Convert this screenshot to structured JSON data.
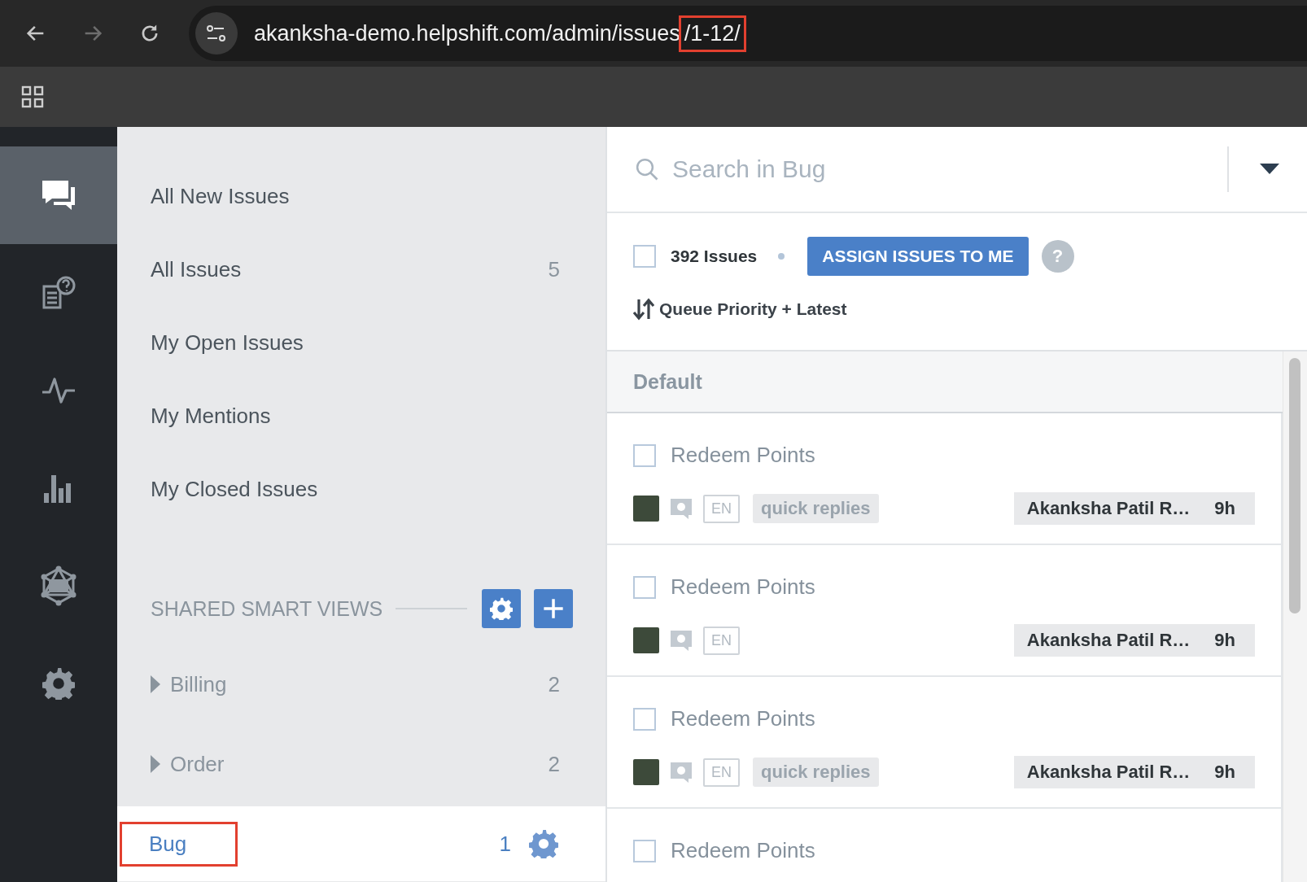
{
  "browser": {
    "url": "akanksha-demo.helpshift.com/admin/issues",
    "url_highlight": "/1-12/"
  },
  "rail": [
    {
      "kind": "chat",
      "selected": true
    },
    {
      "kind": "faq",
      "selected": false
    },
    {
      "kind": "pulse",
      "selected": false
    },
    {
      "kind": "chart",
      "selected": false
    },
    {
      "kind": "ai",
      "selected": false
    },
    {
      "kind": "gear",
      "selected": false
    }
  ],
  "nav": {
    "items": [
      {
        "label": "All New Issues"
      },
      {
        "label": "All Issues",
        "count": "5"
      },
      {
        "label": "My Open Issues"
      },
      {
        "label": "My Mentions"
      },
      {
        "label": "My Closed Issues"
      }
    ]
  },
  "shared_views": {
    "title": "SHARED SMART VIEWS",
    "items": [
      {
        "label": "Billing",
        "count": "2",
        "expandable": true,
        "selected": false,
        "highlighted": false
      },
      {
        "label": "Order",
        "count": "2",
        "expandable": true,
        "selected": false,
        "highlighted": false
      },
      {
        "label": "Bug",
        "count": "1",
        "expandable": false,
        "selected": true,
        "highlighted": true
      }
    ]
  },
  "search": {
    "placeholder": "Search in Bug"
  },
  "bulk": {
    "checked": false,
    "count": "392 Issues",
    "button": "ASSIGN ISSUES TO ME",
    "help": "?"
  },
  "sort": {
    "label": "Queue Priority + Latest"
  },
  "queue": {
    "title": "Default",
    "issues": [
      {
        "title": "Redeem Points",
        "checked": false,
        "language": "EN",
        "tags": [
          "quick replies"
        ],
        "assignee": "Akanksha Patil R…",
        "age": "9h"
      },
      {
        "title": "Redeem Points",
        "checked": false,
        "language": "EN",
        "assignee": "Akanksha Patil R…",
        "age": "9h"
      },
      {
        "title": "Redeem Points",
        "checked": false,
        "language": "EN",
        "tags": [
          "quick replies"
        ],
        "assignee": "Akanksha Patil R…",
        "age": "9h"
      },
      {
        "title": "Redeem Points",
        "checked": false
      }
    ]
  }
}
